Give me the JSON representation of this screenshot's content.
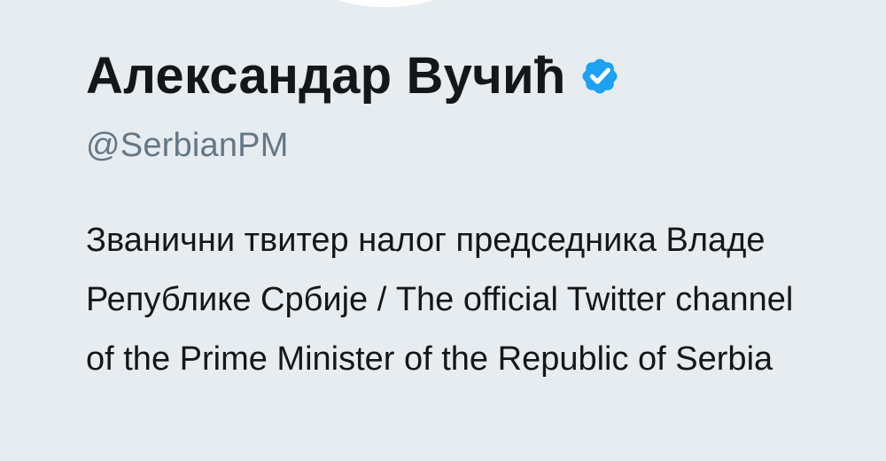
{
  "profile": {
    "display_name": "Александар Вучић",
    "handle": "@SerbianPM",
    "bio": "Званични твитер налог председника Владе Републике Србије / The official Twitter channel of the Prime Minister of the Republic of Serbia",
    "verified": true
  },
  "icons": {
    "verified_badge": "verified-badge-icon",
    "avatar": "avatar-image"
  },
  "colors": {
    "background": "#e6ecf0",
    "name_text": "#14171a",
    "handle_text": "#657786",
    "verified_blue": "#1da1f2"
  }
}
